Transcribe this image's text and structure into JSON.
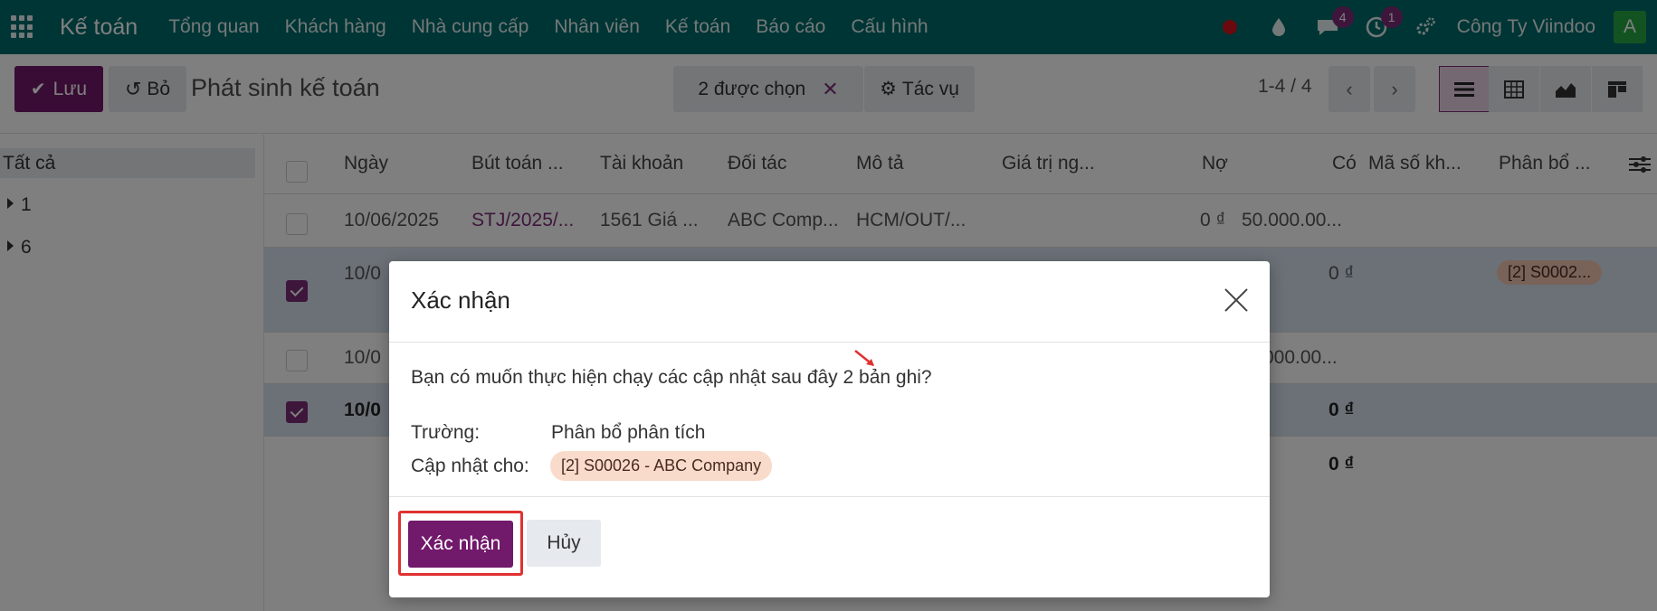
{
  "navbar": {
    "brand": "Kế toán",
    "menu": [
      "Tổng quan",
      "Khách hàng",
      "Nhà cung cấp",
      "Nhân viên",
      "Kế toán",
      "Báo cáo",
      "Cấu hình"
    ],
    "messages_badge": "4",
    "activities_badge": "1",
    "company": "Công Ty Viindoo",
    "avatar_initial": "A"
  },
  "control": {
    "save_label": "Lưu",
    "discard_label": "Bỏ",
    "title": "Phát sinh kế toán",
    "selected_label": "2 được chọn",
    "actions_label": "Tác vụ",
    "pager": "1-4 / 4"
  },
  "sidebar": {
    "all_label": "Tất cả",
    "groups": [
      "1",
      "6"
    ]
  },
  "table": {
    "headers": [
      "Ngày",
      "Bút toán ...",
      "Tài khoản",
      "Đối tác",
      "Mô tả",
      "Giá trị ng...",
      "Nợ",
      "Có",
      "Mã số kh...",
      "Phân bổ ..."
    ],
    "row1": {
      "date": "10/06/2025",
      "entry": "STJ/2025/...",
      "account": "1561 Giá ...",
      "partner": "ABC Comp...",
      "label": "HCM/OUT/...",
      "debit": "0 ₫",
      "credit": "50.000.00..."
    },
    "row2": {
      "date": "10/0",
      "credit": "0 ₫",
      "analytic": "[2] S0002..."
    },
    "row3": {
      "date": "10/0",
      "credit": "000.00..."
    },
    "row4": {
      "date": "10/0",
      "credit": "0 ₫"
    },
    "total": "0 ₫"
  },
  "modal": {
    "title": "Xác nhận",
    "question": "Bạn có muốn thực hiện chạy các cập nhật sau đây 2 bản ghi?",
    "field_label": "Trường:",
    "field_value": "Phân bổ phân tích",
    "update_label": "Cập nhật cho:",
    "update_value": "[2] S00026 - ABC Company",
    "confirm_label": "Xác nhận",
    "cancel_label": "Hủy"
  },
  "colors": {
    "navbar": "#016b6b",
    "primary": "#71196b",
    "highlight": "#e03131"
  }
}
